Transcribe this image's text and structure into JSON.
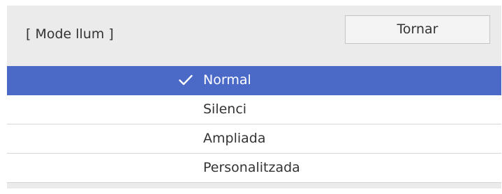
{
  "header": {
    "title": "[ Mode llum ]",
    "return_label": "Tornar"
  },
  "options": [
    {
      "label": "Normal",
      "selected": true
    },
    {
      "label": "Silenci",
      "selected": false
    },
    {
      "label": "Ampliada",
      "selected": false
    },
    {
      "label": "Personalitzada",
      "selected": false
    }
  ],
  "icons": {
    "selected_marker": "check-icon"
  },
  "colors": {
    "panel_background": "#ebebeb",
    "selected_row": "#4b6ac8",
    "row_background": "#ffffff",
    "text": "#333333",
    "selected_text": "#ffffff"
  }
}
